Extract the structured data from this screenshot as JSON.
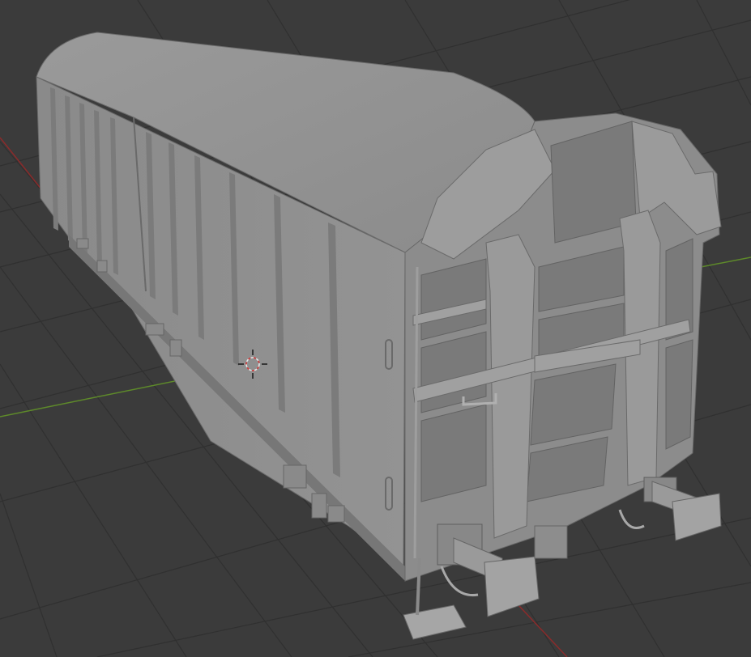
{
  "viewport": {
    "mode": "3d-viewport",
    "background_color": "#3b3b3b",
    "grid_color": "#2f2f2f",
    "x_axis_color": "#8a2b2b",
    "y_axis_color": "#5e8a2a",
    "model_color": "#8e8e8e",
    "model": "boxcar-wagon",
    "cursor": "3d-cursor-icon"
  }
}
